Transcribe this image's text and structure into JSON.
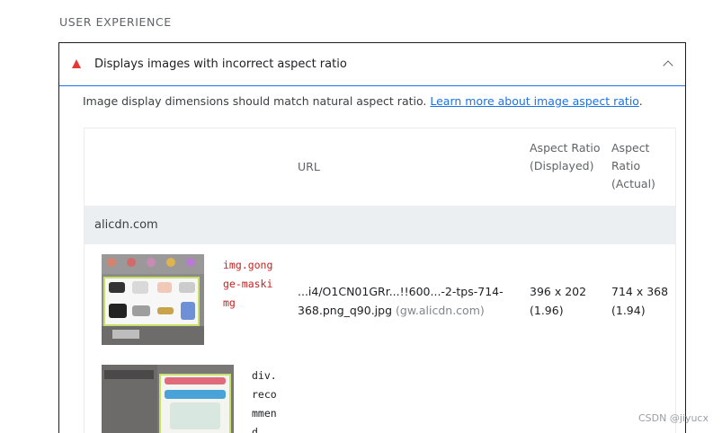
{
  "section": {
    "title": "USER EXPERIENCE"
  },
  "audit": {
    "title": "Displays images with incorrect aspect ratio",
    "description": "Image display dimensions should match natural aspect ratio. ",
    "link_text": "Learn more about image aspect ratio",
    "description_end": ".",
    "status_color": "#e53935",
    "icons": {
      "status": "fail-triangle-icon",
      "toggle": "chevron-up-icon"
    }
  },
  "table": {
    "headers": {
      "url": "URL",
      "displayed": "Aspect Ratio (Displayed)",
      "actual": "Aspect Ratio (Actual)"
    },
    "group": "alicdn.com",
    "rows": [
      {
        "node": "img.gongge-maskimg",
        "url": "...i4/O1CN01GRr...!!600...-2-tps-714-368.png_q90.jpg",
        "origin": "(gw.alicdn.com)",
        "displayed": "396 x 202 (1.96)",
        "actual": "714 x 368 (1.94)"
      },
      {
        "node": "div.recommend"
      }
    ]
  },
  "watermark": "CSDN @jiyucx",
  "colors": {
    "accent": "#1a73e8",
    "node": "#c5221f",
    "highlight": "#c6e06b"
  }
}
